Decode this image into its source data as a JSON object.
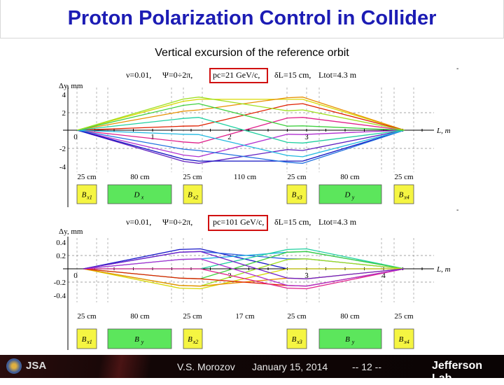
{
  "title": "Proton Polarization Control in Collider",
  "subtitle": "Vertical excursion of the reference orbit",
  "footer": {
    "author": "V.S. Morozov",
    "date": "January 15, 2014",
    "page": "-- 12 --",
    "lab": "Jefferson Lab",
    "logo_text": "JSA"
  },
  "chart_data": [
    {
      "type": "line",
      "params": {
        "nu": "ν=0.01,",
        "psi": "Ψ=0÷2π,",
        "pc": "pc=21 GeV/c,",
        "dl": "δL=15 cm,",
        "ltot": "Ltot=4.3 m"
      },
      "ylabel": "Δy, mm",
      "xlabel": "L, m",
      "yticks": [
        "4",
        "2",
        "-2",
        "-4"
      ],
      "xticks": [
        "0",
        "1",
        "2",
        "3"
      ],
      "ylim": [
        -4,
        4
      ],
      "xlim": [
        0,
        4.3
      ],
      "grid": "dashed",
      "spans": [
        "25 cm",
        "80 cm",
        "25 cm",
        "110 cm",
        "25 cm",
        "80 cm",
        "25 cm"
      ],
      "magnets": [
        {
          "name": "B",
          "sub": "x1"
        },
        {
          "name": "D",
          "sub": "x"
        },
        {
          "name": "B",
          "sub": "x2"
        },
        {
          "name": "B",
          "sub": "x3"
        },
        {
          "name": "D",
          "sub": "y"
        },
        {
          "name": "B",
          "sub": "x4"
        }
      ],
      "x": [
        0.02,
        1.4,
        1.6,
        2.75,
        2.95,
        4.27
      ],
      "series": [
        {
          "color": "#d8d800",
          "values": [
            0,
            3.2,
            3.42,
            3.42,
            3.42,
            0
          ]
        },
        {
          "color": "#e89000",
          "values": [
            0,
            2.1,
            2.25,
            3.6,
            3.67,
            0
          ]
        },
        {
          "color": "#e02000",
          "values": [
            0,
            0.45,
            0.48,
            2.8,
            2.94,
            0
          ]
        },
        {
          "color": "#e0208a",
          "values": [
            0,
            -1.3,
            -1.42,
            1.35,
            1.42,
            0
          ]
        },
        {
          "color": "#b030d0",
          "values": [
            0,
            -2.75,
            -2.94,
            -0.45,
            -0.48,
            0
          ]
        },
        {
          "color": "#6020c0",
          "values": [
            0,
            -3.45,
            -3.67,
            -2.15,
            -2.25,
            0
          ]
        },
        {
          "color": "#1010c0",
          "values": [
            0,
            -3.2,
            -3.42,
            -3.42,
            -3.42,
            0
          ]
        },
        {
          "color": "#2070e0",
          "values": [
            0,
            -2.1,
            -2.25,
            -3.55,
            -3.67,
            0
          ]
        },
        {
          "color": "#20b8e0",
          "values": [
            0,
            -0.45,
            -0.48,
            -2.8,
            -2.94,
            0
          ]
        },
        {
          "color": "#20d0a0",
          "values": [
            0,
            1.3,
            1.42,
            -1.35,
            -1.42,
            0
          ]
        },
        {
          "color": "#40d040",
          "values": [
            0,
            2.75,
            2.94,
            0.45,
            0.48,
            0
          ]
        },
        {
          "color": "#a0e020",
          "values": [
            0,
            3.45,
            3.67,
            2.15,
            2.25,
            0
          ]
        }
      ]
    },
    {
      "type": "line",
      "params": {
        "nu": "ν=0.01,",
        "psi": "Ψ=0÷2π,",
        "pc": "pc=101 GeV/c,",
        "dl": "δL=15 cm,",
        "ltot": "Ltot=4.3 m"
      },
      "ylabel": "Δy, mm",
      "xlabel": "L, m",
      "yticks": [
        "0.4",
        "0.2",
        "-0.2",
        "-0.4"
      ],
      "xticks": [
        "0",
        "2",
        "3",
        "4"
      ],
      "ylim": [
        -0.4,
        0.4
      ],
      "xlim": [
        0,
        4.3
      ],
      "grid": "dashed",
      "spans": [
        "25 cm",
        "80 cm",
        "25 cm",
        "17 cm",
        "25 cm",
        "80 cm",
        "25 cm"
      ],
      "magnets": [
        {
          "name": "B",
          "sub": "x1"
        },
        {
          "name": "B",
          "sub": "y"
        },
        {
          "name": "B",
          "sub": "x2"
        },
        {
          "name": "B",
          "sub": "x3"
        },
        {
          "name": "B",
          "sub": "y"
        },
        {
          "name": "B",
          "sub": "x4"
        }
      ],
      "x": [
        0.1,
        1.35,
        1.62,
        2.75,
        3.0,
        4.27
      ],
      "series": [
        {
          "color": "#1818c8",
          "values": [
            0,
            0.29,
            0.3,
            0.0,
            0.0,
            0
          ]
        },
        {
          "color": "#3060e0",
          "values": [
            0,
            0.25,
            0.26,
            0.15,
            0.15,
            0
          ]
        },
        {
          "color": "#20b0e0",
          "values": [
            0,
            0.14,
            0.15,
            0.25,
            0.26,
            0
          ]
        },
        {
          "color": "#20d0a0",
          "values": [
            0,
            0.0,
            0.0,
            0.29,
            0.3,
            0
          ]
        },
        {
          "color": "#40d040",
          "values": [
            0,
            -0.14,
            -0.15,
            0.25,
            0.26,
            0
          ]
        },
        {
          "color": "#a0e020",
          "values": [
            0,
            -0.25,
            -0.26,
            0.14,
            0.15,
            0
          ]
        },
        {
          "color": "#d8d800",
          "values": [
            0,
            -0.29,
            -0.3,
            0.0,
            0.0,
            0
          ]
        },
        {
          "color": "#e89000",
          "values": [
            0,
            -0.25,
            -0.26,
            -0.14,
            -0.15,
            0
          ]
        },
        {
          "color": "#e02000",
          "values": [
            0,
            -0.14,
            -0.15,
            -0.25,
            -0.26,
            0
          ]
        },
        {
          "color": "#e0208a",
          "values": [
            0,
            0.0,
            0.0,
            -0.29,
            -0.3,
            0
          ]
        },
        {
          "color": "#b030d0",
          "values": [
            0,
            0.14,
            0.15,
            -0.25,
            -0.26,
            0
          ]
        },
        {
          "color": "#7020c8",
          "values": [
            0,
            0.25,
            0.26,
            -0.14,
            -0.15,
            0
          ]
        }
      ]
    }
  ]
}
